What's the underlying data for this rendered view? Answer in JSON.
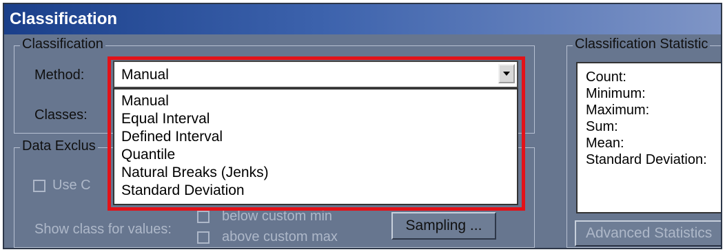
{
  "window": {
    "title": "Classification"
  },
  "classification_group": {
    "legend": "Classification",
    "method_label": "Method:",
    "method_value": "Manual",
    "classes_label": "Classes:",
    "options": [
      "Manual",
      "Equal Interval",
      "Defined Interval",
      "Quantile",
      "Natural Breaks (Jenks)",
      "Standard Deviation"
    ]
  },
  "data_exclusion_group": {
    "legend": "Data Exclus",
    "use_custom_label": "Use C",
    "show_class_label": "Show class for values:",
    "below_label": "below custom min",
    "above_label": "above custom max",
    "sampling_button": "Sampling ..."
  },
  "statistics_group": {
    "legend": "Classification Statistic",
    "items": [
      "Count:",
      "Minimum:",
      "Maximum:",
      "Sum:",
      "Mean:",
      "Standard Deviation:"
    ],
    "advanced_button": "Advanced Statistics"
  },
  "colors": {
    "highlight": "#e31218",
    "panel": "#67768f",
    "titlebar": "#1a3f8a"
  }
}
